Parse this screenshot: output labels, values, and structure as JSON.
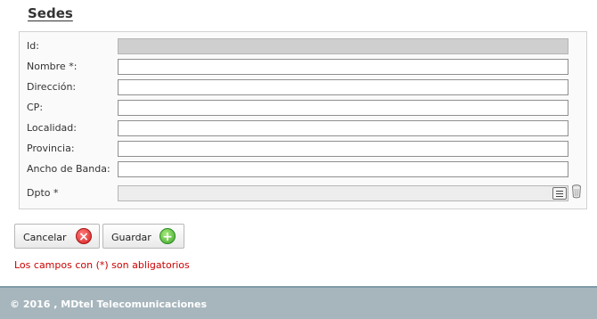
{
  "page": {
    "title": "Sedes"
  },
  "form": {
    "id_label": "Id:",
    "id_value": "",
    "nombre_label": "Nombre *:",
    "nombre_value": "",
    "direccion_label": "Dirección:",
    "direccion_value": "",
    "cp_label": "CP:",
    "cp_value": "",
    "localidad_label": "Localidad:",
    "localidad_value": "",
    "provincia_label": "Provincia:",
    "provincia_value": "",
    "ancho_label": "Ancho de Banda:",
    "ancho_value": "",
    "dpto_label": "Dpto *",
    "dpto_value": "",
    "lookup_icon": "list-icon",
    "clear_icon": "trash-icon"
  },
  "actions": {
    "cancel_label": "Cancelar",
    "cancel_icon": "cancel-icon",
    "save_label": "Guardar",
    "save_icon": "add-icon"
  },
  "notice": {
    "required_text": "Los campos con (*) son abligatorios"
  },
  "footer": {
    "copyright": "© 2016 , MDtel Telecomunicaciones"
  },
  "colors": {
    "footer_bg": "#a7b6bd",
    "required_text": "#cc0000",
    "cancel": "#d52020",
    "save": "#3fa82d"
  }
}
